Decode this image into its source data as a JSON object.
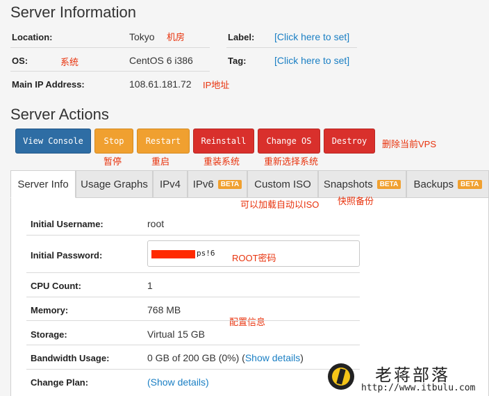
{
  "server_info": {
    "title": "Server Information",
    "rows": [
      {
        "label": "Location:",
        "value": "Tokyo",
        "note": "机房"
      },
      {
        "label": "OS:",
        "note": "系统",
        "value": "CentOS 6 i386"
      },
      {
        "label": "Main IP Address:",
        "value": "108.61.181.72",
        "note": "IP地址"
      }
    ],
    "right_rows": [
      {
        "label": "Label:",
        "value": "[Click here to set]"
      },
      {
        "label": "Tag:",
        "value": "[Click here to set]"
      }
    ]
  },
  "actions": {
    "title": "Server Actions",
    "buttons": [
      {
        "label": "View Console",
        "note": ""
      },
      {
        "label": "Stop",
        "note": "暂停"
      },
      {
        "label": "Restart",
        "note": "重启"
      },
      {
        "label": "Reinstall",
        "note": "重装系统"
      },
      {
        "label": "Change OS",
        "note": "重新选择系统"
      },
      {
        "label": "Destroy",
        "note": "删除当前VPS"
      }
    ]
  },
  "tabs": [
    {
      "label": "Server Info",
      "badge": ""
    },
    {
      "label": "Usage Graphs",
      "badge": ""
    },
    {
      "label": "IPv4",
      "badge": ""
    },
    {
      "label": "IPv6",
      "badge": "BETA"
    },
    {
      "label": "Custom ISO",
      "badge": ""
    },
    {
      "label": "Snapshots",
      "badge": "BETA"
    },
    {
      "label": "Backups",
      "badge": "BETA"
    }
  ],
  "tab_notes": {
    "custom_iso": "可以加载自动以ISO",
    "snapshots": "快照备份"
  },
  "details": {
    "username_label": "Initial Username:",
    "username_value": "root",
    "password_label": "Initial Password:",
    "password_suffix": "ps!6",
    "password_note": "ROOT密码",
    "cpu_label": "CPU Count:",
    "cpu_value": "1",
    "memory_label": "Memory:",
    "memory_value": "768 MB",
    "config_note": "配置信息",
    "storage_label": "Storage:",
    "storage_value": "Virtual 15 GB",
    "bandwidth_label": "Bandwidth Usage:",
    "bandwidth_value": "0 GB of 200 GB (0%) (",
    "bandwidth_link": "Show details",
    "bandwidth_close": ")",
    "plan_label": "Change Plan:",
    "plan_link": "(Show details)"
  },
  "watermark": {
    "title": "老蒋部落",
    "url": "http://www.itbulu.com"
  },
  "colors": {
    "accent_link": "#1a7fc4",
    "annotation": "#e8320c",
    "badge": "#f0a030",
    "btn_blue": "#2e6da4",
    "btn_orange": "#f0a030",
    "btn_red": "#d9302c"
  }
}
